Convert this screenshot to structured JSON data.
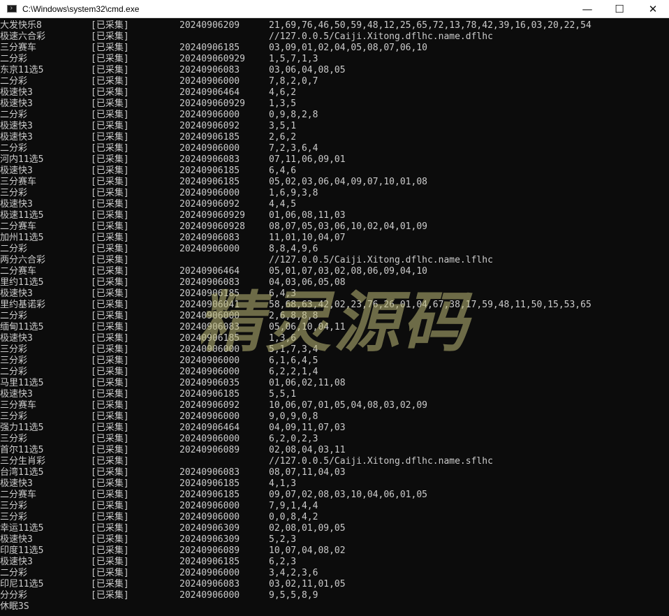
{
  "window": {
    "title": "C:\\Windows\\system32\\cmd.exe",
    "icon": "cmd-icon",
    "minimize_glyph": "—",
    "maximize_glyph": "☐",
    "close_glyph": "✕"
  },
  "watermark": "精灵源码",
  "lines": [
    {
      "name": "大发快乐8",
      "status": "[已采集]",
      "issue": "20240906209",
      "nums": "21,69,76,46,50,59,48,12,25,65,72,13,78,42,39,16,03,20,22,54"
    },
    {
      "name": "极速六合彩",
      "status": "[已采集]",
      "issue": "",
      "nums": "//127.0.0.5/Caiji.Xitong.dflhc.name.dflhc"
    },
    {
      "name": "三分赛车",
      "status": "[已采集]",
      "issue": "20240906185",
      "nums": "03,09,01,02,04,05,08,07,06,10"
    },
    {
      "name": "二分彩",
      "status": "[已采集]",
      "issue": "202409060929",
      "nums": "1,5,7,1,3"
    },
    {
      "name": "东京11选5",
      "status": "[已采集]",
      "issue": "20240906083",
      "nums": "03,06,04,08,05"
    },
    {
      "name": "二分彩",
      "status": "[已采集]",
      "issue": "20240906000",
      "nums": "7,8,2,0,7"
    },
    {
      "name": "极速快3",
      "status": "[已采集]",
      "issue": "20240906464",
      "nums": "4,6,2"
    },
    {
      "name": "极速快3",
      "status": "[已采集]",
      "issue": "202409060929",
      "nums": "1,3,5"
    },
    {
      "name": "二分彩",
      "status": "[已采集]",
      "issue": "20240906000",
      "nums": "0,9,8,2,8"
    },
    {
      "name": "极速快3",
      "status": "[已采集]",
      "issue": "20240906092",
      "nums": "3,5,1"
    },
    {
      "name": "极速快3",
      "status": "[已采集]",
      "issue": "20240906185",
      "nums": "2,6,2"
    },
    {
      "name": "二分彩",
      "status": "[已采集]",
      "issue": "20240906000",
      "nums": "7,2,3,6,4"
    },
    {
      "name": "河内11选5",
      "status": "[已采集]",
      "issue": "20240906083",
      "nums": "07,11,06,09,01"
    },
    {
      "name": "极速快3",
      "status": "[已采集]",
      "issue": "20240906185",
      "nums": "6,4,6"
    },
    {
      "name": "三分赛车",
      "status": "[已采集]",
      "issue": "20240906185",
      "nums": "05,02,03,06,04,09,07,10,01,08"
    },
    {
      "name": "三分彩",
      "status": "[已采集]",
      "issue": "20240906000",
      "nums": "1,6,9,3,8"
    },
    {
      "name": "极速快3",
      "status": "[已采集]",
      "issue": "20240906092",
      "nums": "4,4,5"
    },
    {
      "name": "极速11选5",
      "status": "[已采集]",
      "issue": "202409060929",
      "nums": "01,06,08,11,03"
    },
    {
      "name": "二分赛车",
      "status": "[已采集]",
      "issue": "202409060928",
      "nums": "08,07,05,03,06,10,02,04,01,09"
    },
    {
      "name": "加州11选5",
      "status": "[已采集]",
      "issue": "20240906083",
      "nums": "11,01,10,04,07"
    },
    {
      "name": "二分彩",
      "status": "[已采集]",
      "issue": "20240906000",
      "nums": "8,8,4,9,6"
    },
    {
      "name": "两分六合彩",
      "status": "[已采集]",
      "issue": "",
      "nums": "//127.0.0.5/Caiji.Xitong.dflhc.name.lflhc"
    },
    {
      "name": "二分赛车",
      "status": "[已采集]",
      "issue": "20240906464",
      "nums": "05,01,07,03,02,08,06,09,04,10"
    },
    {
      "name": "里约11选5",
      "status": "[已采集]",
      "issue": "20240906083",
      "nums": "04,03,06,05,08"
    },
    {
      "name": "极速快3",
      "status": "[已采集]",
      "issue": "20240906185",
      "nums": "6,4,3"
    },
    {
      "name": "里约基诺彩",
      "status": "[已采集]",
      "issue": "20240906041",
      "nums": "58,68,63,42,02,23,76,26,01,04,67,38,17,59,48,11,50,15,53,65"
    },
    {
      "name": "二分彩",
      "status": "[已采集]",
      "issue": "20240906000",
      "nums": "2,6,8,8,8"
    },
    {
      "name": "缅甸11选5",
      "status": "[已采集]",
      "issue": "20240906083",
      "nums": "05,06,10,04,11"
    },
    {
      "name": "极速快3",
      "status": "[已采集]",
      "issue": "20240906185",
      "nums": "1,3,6"
    },
    {
      "name": "三分彩",
      "status": "[已采集]",
      "issue": "20240906000",
      "nums": "5,1,7,3,4"
    },
    {
      "name": "三分彩",
      "status": "[已采集]",
      "issue": "20240906000",
      "nums": "6,1,6,4,5"
    },
    {
      "name": "二分彩",
      "status": "[已采集]",
      "issue": "20240906000",
      "nums": "6,2,2,1,4"
    },
    {
      "name": "马里11选5",
      "status": "[已采集]",
      "issue": "20240906035",
      "nums": "01,06,02,11,08"
    },
    {
      "name": "极速快3",
      "status": "[已采集]",
      "issue": "20240906185",
      "nums": "5,5,1"
    },
    {
      "name": "三分赛车",
      "status": "[已采集]",
      "issue": "20240906092",
      "nums": "10,06,07,01,05,04,08,03,02,09"
    },
    {
      "name": "三分彩",
      "status": "[已采集]",
      "issue": "20240906000",
      "nums": "9,0,9,0,8"
    },
    {
      "name": "强力11选5",
      "status": "[已采集]",
      "issue": "20240906464",
      "nums": "04,09,11,07,03"
    },
    {
      "name": "三分彩",
      "status": "[已采集]",
      "issue": "20240906000",
      "nums": "6,2,0,2,3"
    },
    {
      "name": "首尔11选5",
      "status": "[已采集]",
      "issue": "20240906089",
      "nums": "02,08,04,03,11"
    },
    {
      "name": "三分生肖彩",
      "status": "[已采集]",
      "issue": "",
      "nums": "//127.0.0.5/Caiji.Xitong.dflhc.name.sflhc"
    },
    {
      "name": "台湾11选5",
      "status": "[已采集]",
      "issue": "20240906083",
      "nums": "08,07,11,04,03"
    },
    {
      "name": "极速快3",
      "status": "[已采集]",
      "issue": "20240906185",
      "nums": "4,1,3"
    },
    {
      "name": "二分赛车",
      "status": "[已采集]",
      "issue": "20240906185",
      "nums": "09,07,02,08,03,10,04,06,01,05"
    },
    {
      "name": "三分彩",
      "status": "[已采集]",
      "issue": "20240906000",
      "nums": "7,9,1,4,4"
    },
    {
      "name": "三分彩",
      "status": "[已采集]",
      "issue": "20240906000",
      "nums": "0,0,8,4,2"
    },
    {
      "name": "幸运11选5",
      "status": "[已采集]",
      "issue": "20240906309",
      "nums": "02,08,01,09,05"
    },
    {
      "name": "极速快3",
      "status": "[已采集]",
      "issue": "20240906309",
      "nums": "5,2,3"
    },
    {
      "name": "印度11选5",
      "status": "[已采集]",
      "issue": "20240906089",
      "nums": "10,07,04,08,02"
    },
    {
      "name": "极速快3",
      "status": "[已采集]",
      "issue": "20240906185",
      "nums": "6,2,3"
    },
    {
      "name": "二分彩",
      "status": "[已采集]",
      "issue": "20240906000",
      "nums": "3,4,2,3,6"
    },
    {
      "name": "印尼11选5",
      "status": "[已采集]",
      "issue": "20240906083",
      "nums": "03,02,11,01,05"
    },
    {
      "name": "分分彩",
      "status": "[已采集]",
      "issue": "20240906000",
      "nums": "9,5,5,8,9"
    }
  ],
  "sleep_line": "休眠3S"
}
